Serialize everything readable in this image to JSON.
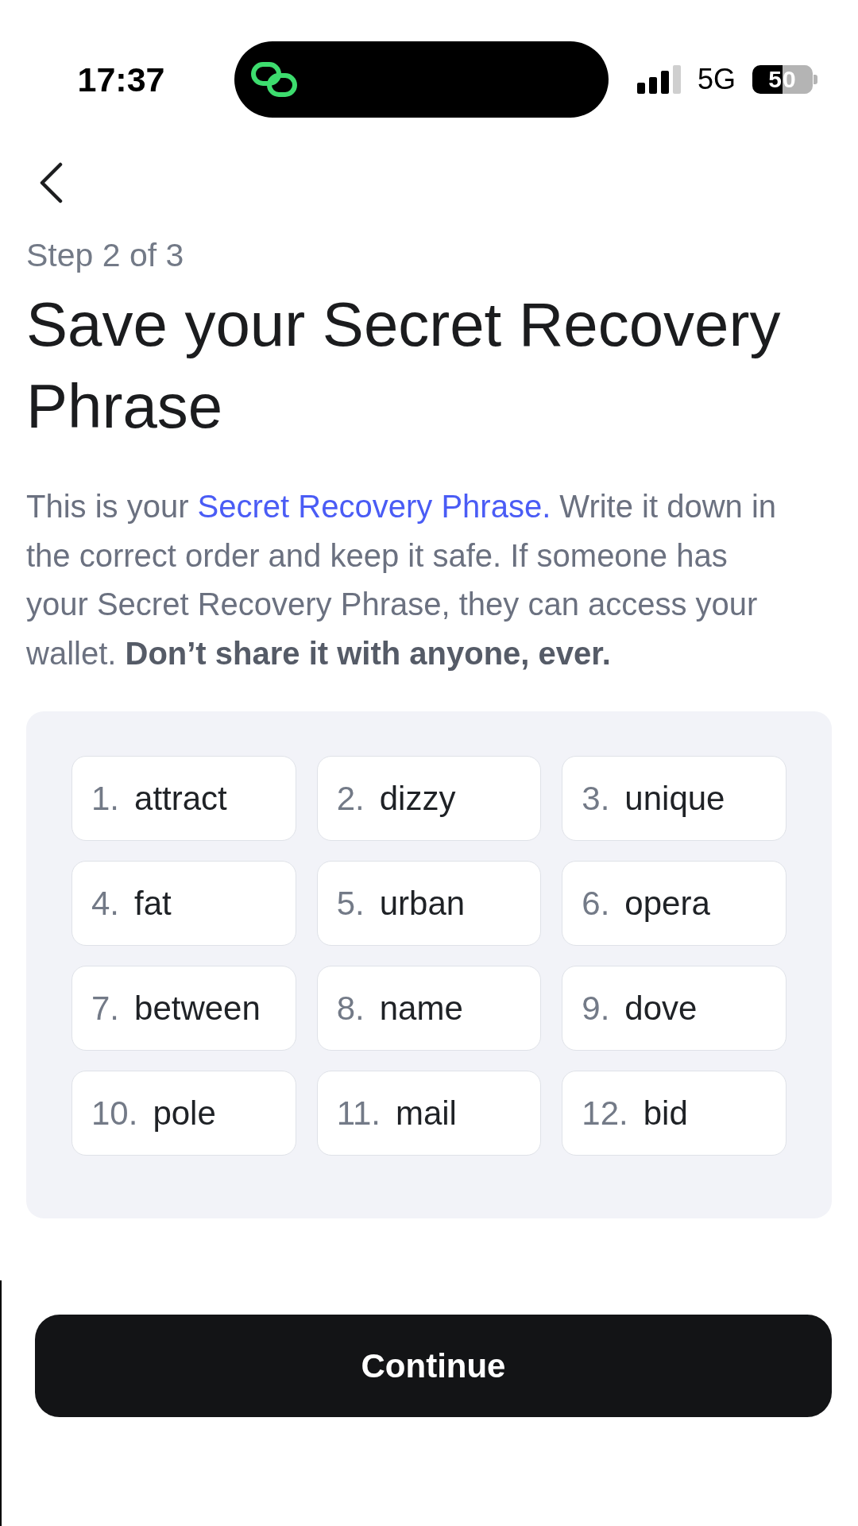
{
  "status_bar": {
    "time": "17:37",
    "network": "5G",
    "battery": "50"
  },
  "header": {
    "step": "Step 2 of 3",
    "title": "Save your Secret Recovery Phrase"
  },
  "intro": {
    "before": "This is your ",
    "link": "Secret Recovery Phrase.",
    "after": " Write it down in the correct order and keep it safe. If someone has your Secret Recovery Phrase, they can access your wallet. **Don’t share it with anyone, ever.**"
  },
  "phrase_words": [
    {
      "number": "1.",
      "word": "attract"
    },
    {
      "number": "2.",
      "word": "dizzy"
    },
    {
      "number": "3.",
      "word": "unique"
    },
    {
      "number": "4.",
      "word": "fat"
    },
    {
      "number": "5.",
      "word": "urban"
    },
    {
      "number": "6.",
      "word": "opera"
    },
    {
      "number": "7.",
      "word": "between"
    },
    {
      "number": "8.",
      "word": "name"
    },
    {
      "number": "9.",
      "word": "dove"
    },
    {
      "number": "10.",
      "word": "pole"
    },
    {
      "number": "11.",
      "word": "mail"
    },
    {
      "number": "12.",
      "word": "bid"
    }
  ],
  "continue_button": {
    "label": "Continue"
  }
}
